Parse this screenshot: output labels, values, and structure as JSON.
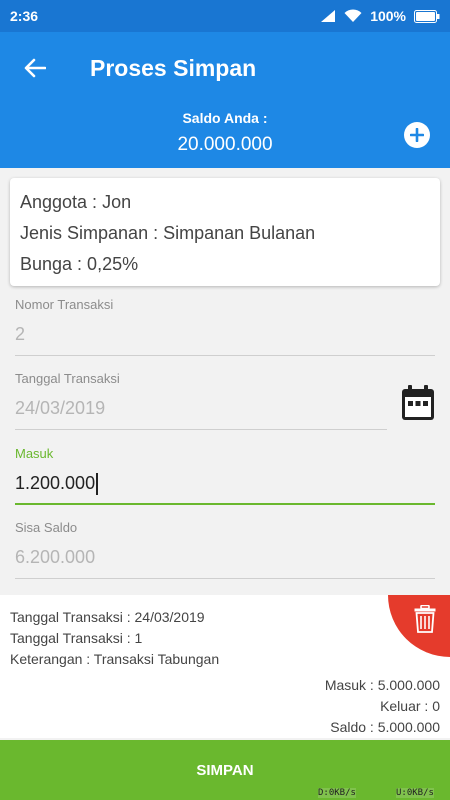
{
  "statusbar": {
    "time": "2:36",
    "battery": "100%"
  },
  "appbar": {
    "title": "Proses Simpan"
  },
  "balance": {
    "label": "Saldo Anda :",
    "amount": "20.000.000"
  },
  "member_info": {
    "member": "Anggota : Jon",
    "savings_type": "Jenis Simpanan : Simpanan Bulanan",
    "interest": "Bunga : 0,25%"
  },
  "form": {
    "transaction_number": {
      "label": "Nomor Transaksi",
      "value": "2"
    },
    "transaction_date": {
      "label": "Tanggal Transaksi",
      "value": "24/03/2019"
    },
    "deposit": {
      "label": "Masuk",
      "value": "1.200.000"
    },
    "remaining_balance": {
      "label": "Sisa Saldo",
      "value": "6.200.000"
    }
  },
  "history": {
    "date": "Tanggal Transaksi : 24/03/2019",
    "number": "Tanggal Transaksi : 1",
    "note": "Keterangan : Transaksi Tabungan",
    "in": "Masuk : 5.000.000",
    "out": "Keluar : 0",
    "balance": "Saldo : 5.000.000"
  },
  "save_button": {
    "label": "SIMPAN"
  },
  "net_speed": {
    "down": "D:0KB/s",
    "up": "U:0KB/s"
  },
  "colors": {
    "primary": "#1e88e5",
    "accent": "#6ab82e",
    "danger": "#e53b2c"
  },
  "icons": [
    "back-arrow-icon",
    "add-icon",
    "calendar-icon",
    "trash-icon",
    "wifi-icon",
    "signal-icon",
    "battery-icon"
  ]
}
